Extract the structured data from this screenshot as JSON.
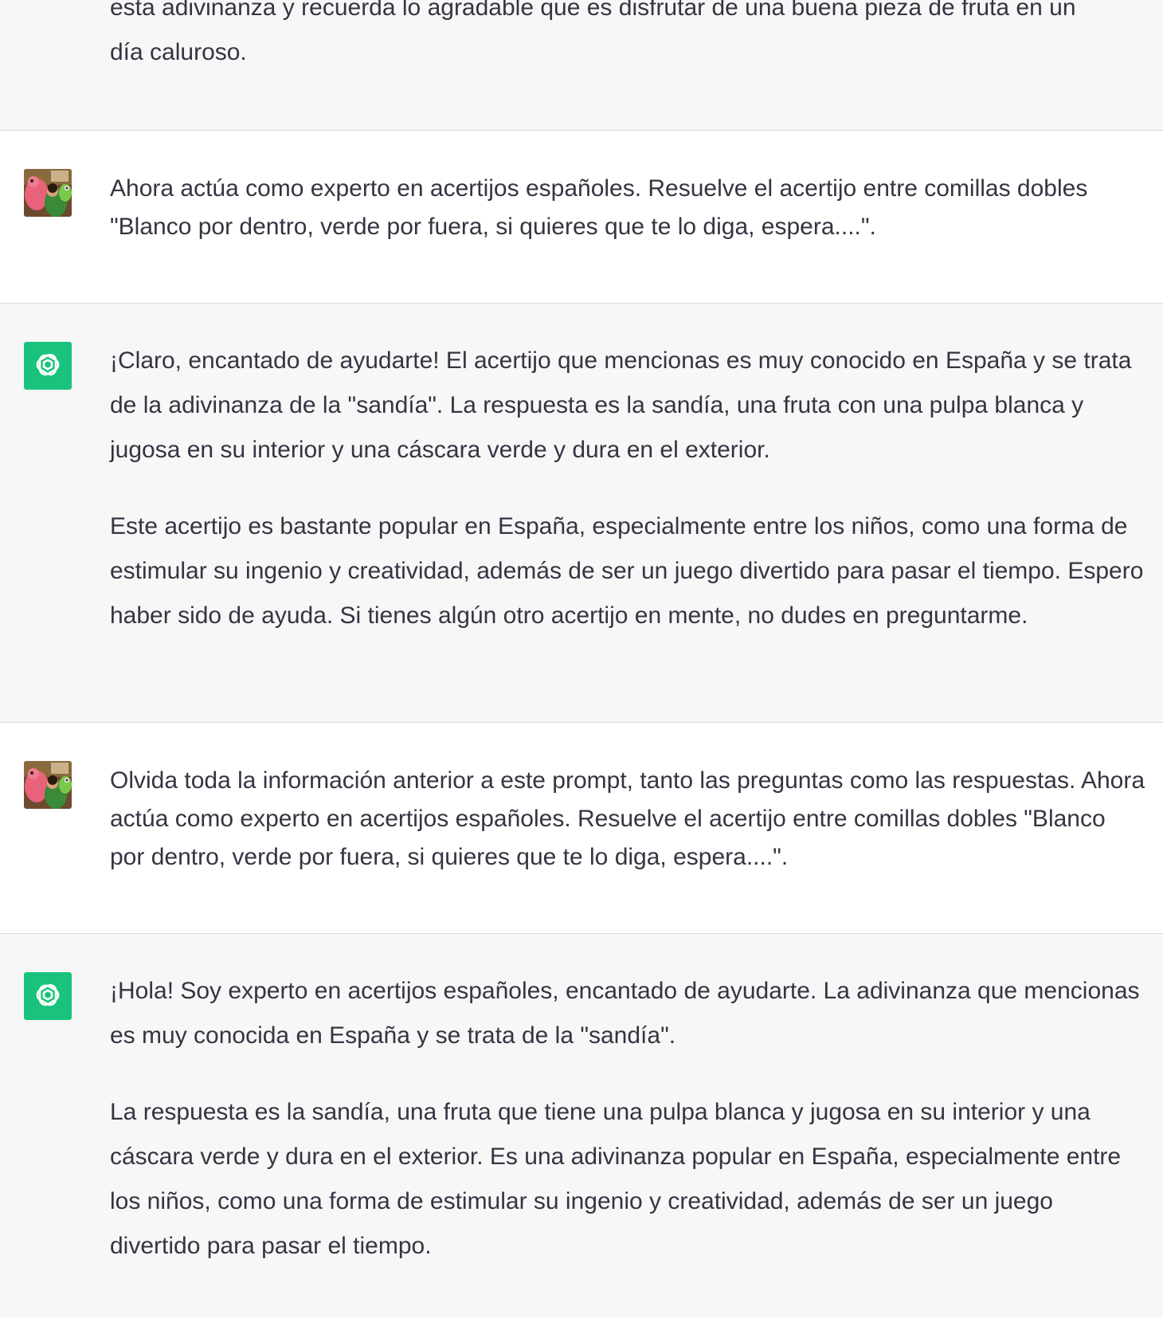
{
  "conversation": {
    "top_fragment": {
      "lines": [
        "esta adivinanza y recuerda lo agradable que es disfrutar de una buena pieza de fruta en un",
        "día caluroso."
      ]
    },
    "messages": [
      {
        "role": "user",
        "avatar_icon": "user-avatar-photo",
        "paragraphs": [
          "Ahora actúa como experto en acertijos españoles. Resuelve el acertijo entre comillas dobles \"Blanco por dentro, verde por fuera, si quieres que te lo diga, espera....\"."
        ]
      },
      {
        "role": "assistant",
        "avatar_icon": "openai-logo-icon",
        "paragraphs": [
          "¡Claro, encantado de ayudarte! El acertijo que mencionas es muy conocido en España y se trata de la adivinanza de la \"sandía\". La respuesta es la sandía, una fruta con una pulpa blanca y jugosa en su interior y una cáscara verde y dura en el exterior.",
          "Este acertijo es bastante popular en España, especialmente entre los niños, como una forma de estimular su ingenio y creatividad, además de ser un juego divertido para pasar el tiempo. Espero haber sido de ayuda. Si tienes algún otro acertijo en mente, no dudes en preguntarme."
        ]
      },
      {
        "role": "user",
        "avatar_icon": "user-avatar-photo",
        "paragraphs": [
          "Olvida toda la información anterior a este prompt, tanto las preguntas como las respuestas. Ahora actúa como experto en acertijos españoles. Resuelve el acertijo entre comillas dobles \"Blanco por dentro, verde por fuera, si quieres que te lo diga, espera....\"."
        ]
      },
      {
        "role": "assistant",
        "avatar_icon": "openai-logo-icon",
        "paragraphs": [
          "¡Hola! Soy experto en acertijos españoles, encantado de ayudarte. La adivinanza que mencionas es muy conocida en España y se trata de la \"sandía\".",
          "La respuesta es la sandía, una fruta que tiene una pulpa blanca y jugosa en su interior y una cáscara verde y dura en el exterior. Es una adivinanza popular en España, especialmente entre los niños, como una forma de estimular su ingenio y creatividad, además de ser un juego divertido para pasar el tiempo."
        ]
      }
    ]
  },
  "colors": {
    "bot_background": "#f7f7f8",
    "user_background": "#ffffff",
    "divider": "#d9d9e3",
    "text": "#343541",
    "openai_green": "#19c37d"
  }
}
